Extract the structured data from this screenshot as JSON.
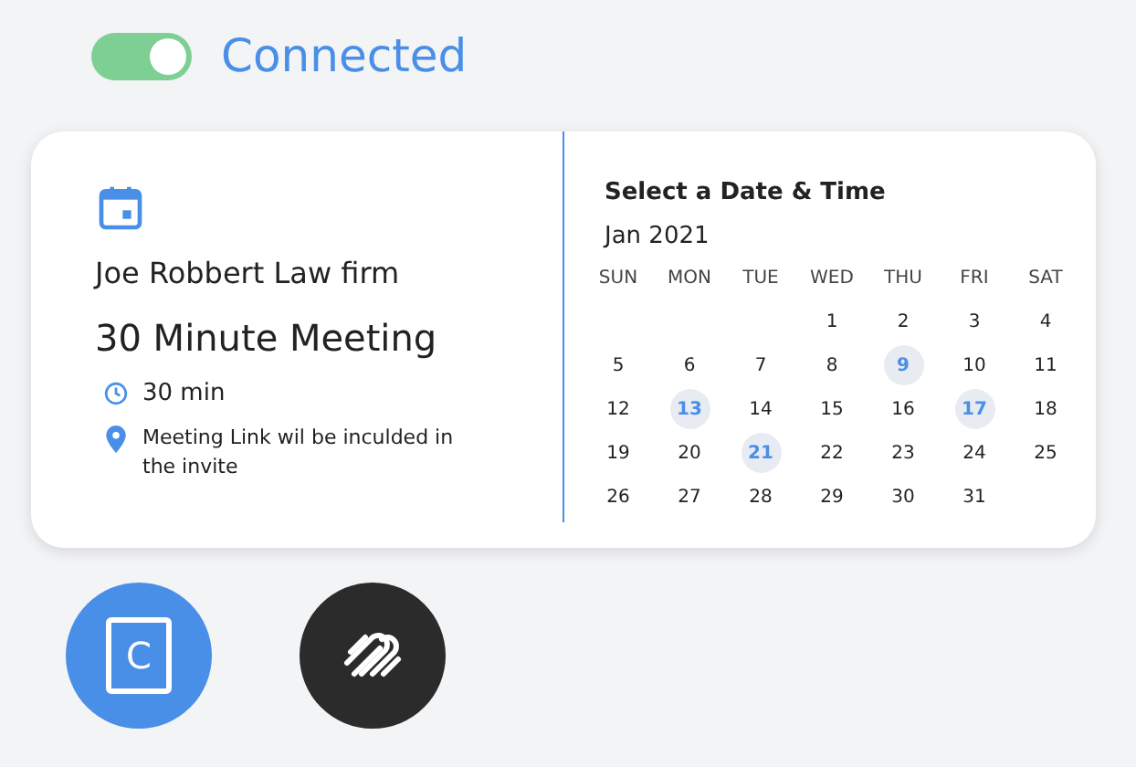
{
  "connection": {
    "on": true,
    "label": "Connected"
  },
  "event": {
    "organizer": "Joe Robbert Law firm",
    "title": "30 Minute Meeting",
    "duration": "30 min",
    "location": "Meeting Link wil be inculded in the invite"
  },
  "calendar": {
    "heading": "Select a Date & Time",
    "month": "Jan 2021",
    "weekdays": [
      "SUN",
      "MON",
      "TUE",
      "WED",
      "THU",
      "FRI",
      "SAT"
    ],
    "weeks": [
      [
        {
          "kind": "blank"
        },
        {
          "kind": "blank"
        },
        {
          "kind": "blank"
        },
        {
          "day": "1",
          "available": false
        },
        {
          "day": "2",
          "available": false
        },
        {
          "day": "3",
          "available": false
        },
        {
          "day": "4",
          "available": false
        }
      ],
      [
        {
          "day": "5",
          "available": false
        },
        {
          "day": "6",
          "available": false
        },
        {
          "day": "7",
          "available": false
        },
        {
          "day": "8",
          "available": false
        },
        {
          "day": "9",
          "available": true
        },
        {
          "day": "10",
          "available": false
        },
        {
          "day": "11",
          "available": false
        }
      ],
      [
        {
          "day": "12",
          "available": false
        },
        {
          "day": "13",
          "available": true
        },
        {
          "day": "14",
          "available": false
        },
        {
          "day": "15",
          "available": false
        },
        {
          "day": "16",
          "available": false
        },
        {
          "day": "17",
          "available": true
        },
        {
          "day": "18",
          "available": false
        }
      ],
      [
        {
          "day": "19",
          "available": false
        },
        {
          "day": "20",
          "available": false
        },
        {
          "day": "21",
          "available": true
        },
        {
          "day": "22",
          "available": false
        },
        {
          "day": "23",
          "available": false
        },
        {
          "day": "24",
          "available": false
        },
        {
          "day": "25",
          "available": false
        }
      ],
      [
        {
          "day": "26",
          "available": false
        },
        {
          "day": "27",
          "available": false
        },
        {
          "day": "28",
          "available": false
        },
        {
          "day": "29",
          "available": false
        },
        {
          "day": "30",
          "available": false
        },
        {
          "day": "31",
          "available": false
        },
        {
          "kind": "blank"
        }
      ]
    ]
  },
  "apps": [
    {
      "kind": "calendar",
      "letter": "C"
    },
    {
      "kind": "paperclips"
    }
  ]
}
